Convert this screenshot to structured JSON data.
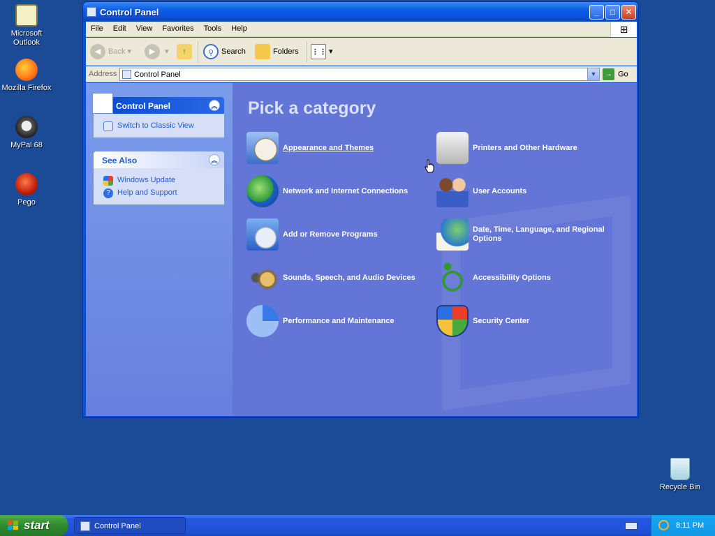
{
  "desktop": {
    "icons": [
      {
        "label": "Microsoft Outlook",
        "icon": "outlook-icon"
      },
      {
        "label": "Mozilla Firefox",
        "icon": "firefox-icon"
      },
      {
        "label": "MyPal 68",
        "icon": "mypal-icon"
      },
      {
        "label": "Pego",
        "icon": "pego-icon"
      },
      {
        "label": "Recycle Bin",
        "icon": "recycle-bin-icon"
      }
    ]
  },
  "window": {
    "title": "Control Panel",
    "menu": [
      "File",
      "Edit",
      "View",
      "Favorites",
      "Tools",
      "Help"
    ],
    "toolbar": {
      "back": "Back",
      "search": "Search",
      "folders": "Folders"
    },
    "address": {
      "label": "Address",
      "value": "Control Panel",
      "go": "Go"
    }
  },
  "sidebar": {
    "control_panel": {
      "title": "Control Panel",
      "link": "Switch to Classic View"
    },
    "see_also": {
      "title": "See Also",
      "links": [
        "Windows Update",
        "Help and Support"
      ]
    }
  },
  "main": {
    "heading": "Pick a category",
    "categories": [
      {
        "label": "Appearance and Themes",
        "icon": "appearance-themes-icon"
      },
      {
        "label": "Printers and Other Hardware",
        "icon": "printer-icon"
      },
      {
        "label": "Network and Internet Connections",
        "icon": "network-icon"
      },
      {
        "label": "User Accounts",
        "icon": "user-accounts-icon"
      },
      {
        "label": "Add or Remove Programs",
        "icon": "add-remove-programs-icon"
      },
      {
        "label": "Date, Time, Language, and Regional Options",
        "icon": "date-time-regional-icon"
      },
      {
        "label": "Sounds, Speech, and Audio Devices",
        "icon": "sounds-icon"
      },
      {
        "label": "Accessibility Options",
        "icon": "accessibility-icon"
      },
      {
        "label": "Performance and Maintenance",
        "icon": "performance-icon"
      },
      {
        "label": "Security Center",
        "icon": "security-shield-icon"
      }
    ]
  },
  "taskbar": {
    "start": "start",
    "task": "Control Panel",
    "clock": "8:11 PM"
  },
  "colors": {
    "desktop": "#1b4a96",
    "content_bg": "#6375d6",
    "title_blue": "#0a4fd8",
    "start_green": "#2f8b2c"
  }
}
